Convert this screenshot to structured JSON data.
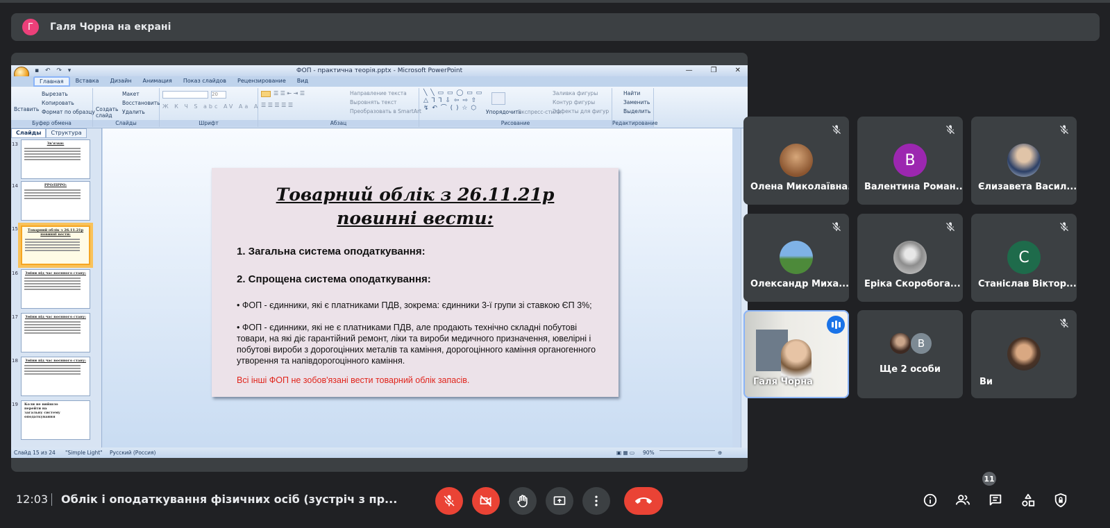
{
  "presentation_bar": {
    "avatar_letter": "Г",
    "avatar_color": "#ec407a",
    "label": "Галя Чорна на екрані"
  },
  "ppt": {
    "window_title": "ФОП - практична теорія.pptx - Microsoft PowerPoint",
    "tabs": [
      "Главная",
      "Вставка",
      "Дизайн",
      "Анимация",
      "Показ слайдов",
      "Рецензирование",
      "Вид"
    ],
    "ribbon": {
      "clipboard": {
        "paste": "Вставить",
        "cut": "Вырезать",
        "copy": "Копировать",
        "format": "Формат по образцу",
        "group": "Буфер обмена"
      },
      "slides": {
        "create": "Создать слайд",
        "layout": "Макет",
        "reset": "Восстановить",
        "delete": "Удалить",
        "group": "Слайды"
      },
      "font": {
        "size": "20",
        "group": "Шрифт"
      },
      "paragraph": {
        "direction": "Направление текста",
        "align": "Выровнять текст",
        "smartart": "Преобразовать в SmartArt",
        "group": "Абзац"
      },
      "drawing": {
        "arrange": "Упорядочить",
        "styles": "Экспресс-стили",
        "fill": "Заливка фигуры",
        "outline": "Контур фигуры",
        "effects": "Эффекты для фигур",
        "group": "Рисование"
      },
      "editing": {
        "find": "Найти",
        "replace": "Заменить",
        "select": "Выделить",
        "group": "Редактирование"
      }
    },
    "panel_tabs": [
      "Слайды",
      "Структура"
    ],
    "thumbs": [
      {
        "num": "13",
        "title": "Зв'язки:"
      },
      {
        "num": "14",
        "title": "РРО/ПРРО:"
      },
      {
        "num": "15",
        "title": "Товарний облік з 26.11.21р повинні вести:"
      },
      {
        "num": "16",
        "title": "Зміни під час воєнного стану:"
      },
      {
        "num": "17",
        "title": "Зміни під час воєнного стану:"
      },
      {
        "num": "18",
        "title": "Зміни під час воєнного стану:"
      },
      {
        "num": "19",
        "title": "Коли не вийшло перейти на загальну систему оподаткування"
      }
    ],
    "slide": {
      "heading": "Товарний облік з 26.11.21р повинні вести:",
      "item1": "1.  Загальна система оподаткування:",
      "item2": "2.  Спрощена система оподаткування:",
      "bullet1": "• ФОП - єдинники, які є платниками ПДВ, зокрема: єдинники 3-ї групи зі ставкою ЄП 3%;",
      "bullet2": "• ФОП - єдинники, які не є платниками ПДВ, але продають технічно складні побутові товари, на які діє гарантійний ремонт, ліки та вироби медичного призначення, ювелірні і побутові вироби з дорогоцінних металів та каміння, дорогоцінного каміння органогенного утворення та напівдорогоцінного каміння.",
      "note": "Всі інші ФОП не зобов'язані вести товарний облік запасів."
    },
    "status": {
      "slide": "Слайд 15 из 24",
      "theme": "\"Simple Light\"",
      "lang": "Русский (Россия)",
      "zoom": "90%"
    }
  },
  "participants": [
    {
      "name": "Олена Миколаївна...",
      "type": "photo",
      "muted": true
    },
    {
      "name": "Валентина Роман...",
      "type": "letter",
      "letter": "В",
      "color": "#9c27b0",
      "muted": true
    },
    {
      "name": "Єлизавета Васил...",
      "type": "photo",
      "muted": true
    },
    {
      "name": "Олександр Миха...",
      "type": "photo",
      "muted": true
    },
    {
      "name": "Еріка Скоробога...",
      "type": "photo",
      "muted": true
    },
    {
      "name": "Станіслав Віктор...",
      "type": "letter",
      "letter": "С",
      "color": "#1e6b4b",
      "muted": true
    },
    {
      "name": "Галя Чорна",
      "type": "video",
      "speaking": true
    },
    {
      "name": "Ще 2 особи",
      "type": "group",
      "letter": "B"
    },
    {
      "name": "Ви",
      "type": "photo",
      "muted": true
    }
  ],
  "bottom": {
    "time": "12:03",
    "meeting_title": "Облік і оподаткування фізичних осіб (зустріч з пр...",
    "people_count": "11"
  },
  "colors": {
    "bg": "#202124",
    "tile": "#3c4043",
    "danger": "#ea4335",
    "accent": "#8ab4f8"
  }
}
